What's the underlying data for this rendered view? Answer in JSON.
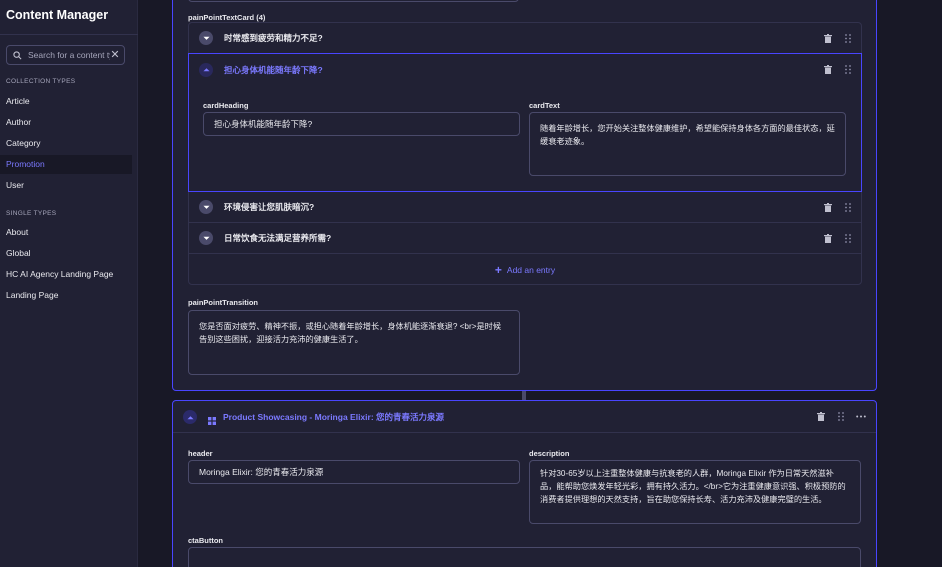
{
  "app": {
    "title": "Content Manager"
  },
  "search": {
    "placeholder": "Search for a content type"
  },
  "nav": {
    "collection_label": "COLLECTION TYPES",
    "collection_items": [
      {
        "label": "Article"
      },
      {
        "label": "Author"
      },
      {
        "label": "Category"
      },
      {
        "label": "Promotion"
      },
      {
        "label": "User"
      }
    ],
    "single_label": "SINGLE TYPES",
    "single_items": [
      {
        "label": "About"
      },
      {
        "label": "Global"
      },
      {
        "label": "HC AI Agency Landing Page"
      },
      {
        "label": "Landing Page"
      }
    ],
    "active_item": "Promotion"
  },
  "pain_point_cards": {
    "label": "painPointTextCard (4)",
    "items": [
      {
        "title": "时常感到疲劳和精力不足?"
      },
      {
        "title": "担心身体机能随年龄下降?"
      },
      {
        "title": "环境侵害让您肌肤暗沉?"
      },
      {
        "title": "日常饮食无法满足营养所需?"
      }
    ],
    "expanded": {
      "heading_label": "cardHeading",
      "heading_value": "担心身体机能随年龄下降?",
      "text_label": "cardText",
      "text_value": "随着年龄增长，您开始关注整体健康维护，希望能保持身体各方面的最佳状态，延缓衰老迹象。"
    },
    "add_entry_label": "Add an entry"
  },
  "transition": {
    "label": "painPointTransition",
    "value": "您是否面对疲劳、精神不振，或担心随着年龄增长，身体机能逐渐衰退? <br>是时候告别这些困扰，迎接活力充沛的健康生活了。"
  },
  "showcase": {
    "title": "Product Showcasing - Moringa Elixir: 您的青春活力泉源",
    "header_label": "header",
    "header_value": "Moringa Elixir: 您的青春活力泉源",
    "description_label": "description",
    "description_value": "针对30-65岁以上注重整体健康与抗衰老的人群，Moringa Elixir 作为日常天然滋补品，能帮助您焕发年轻光彩，拥有持久活力。</br>它为注重健康意识强、积极预防的消费者提供理想的天然支持，旨在助您保持长寿、活力充沛及健康完璧的生活。",
    "cta_label": "ctaButton"
  },
  "colors": {
    "accent": "#4945ff",
    "accent_text": "#7b79ff",
    "background": "#181826",
    "surface": "#212134",
    "border": "#4a4a6a"
  },
  "icons": {
    "search": "search-icon",
    "clear": "close-icon",
    "chevron": "chevron-down-icon",
    "delete": "trash-icon",
    "drag": "drag-handle-icon",
    "more": "more-icon",
    "component": "component-grid-icon",
    "add": "plus-icon"
  }
}
